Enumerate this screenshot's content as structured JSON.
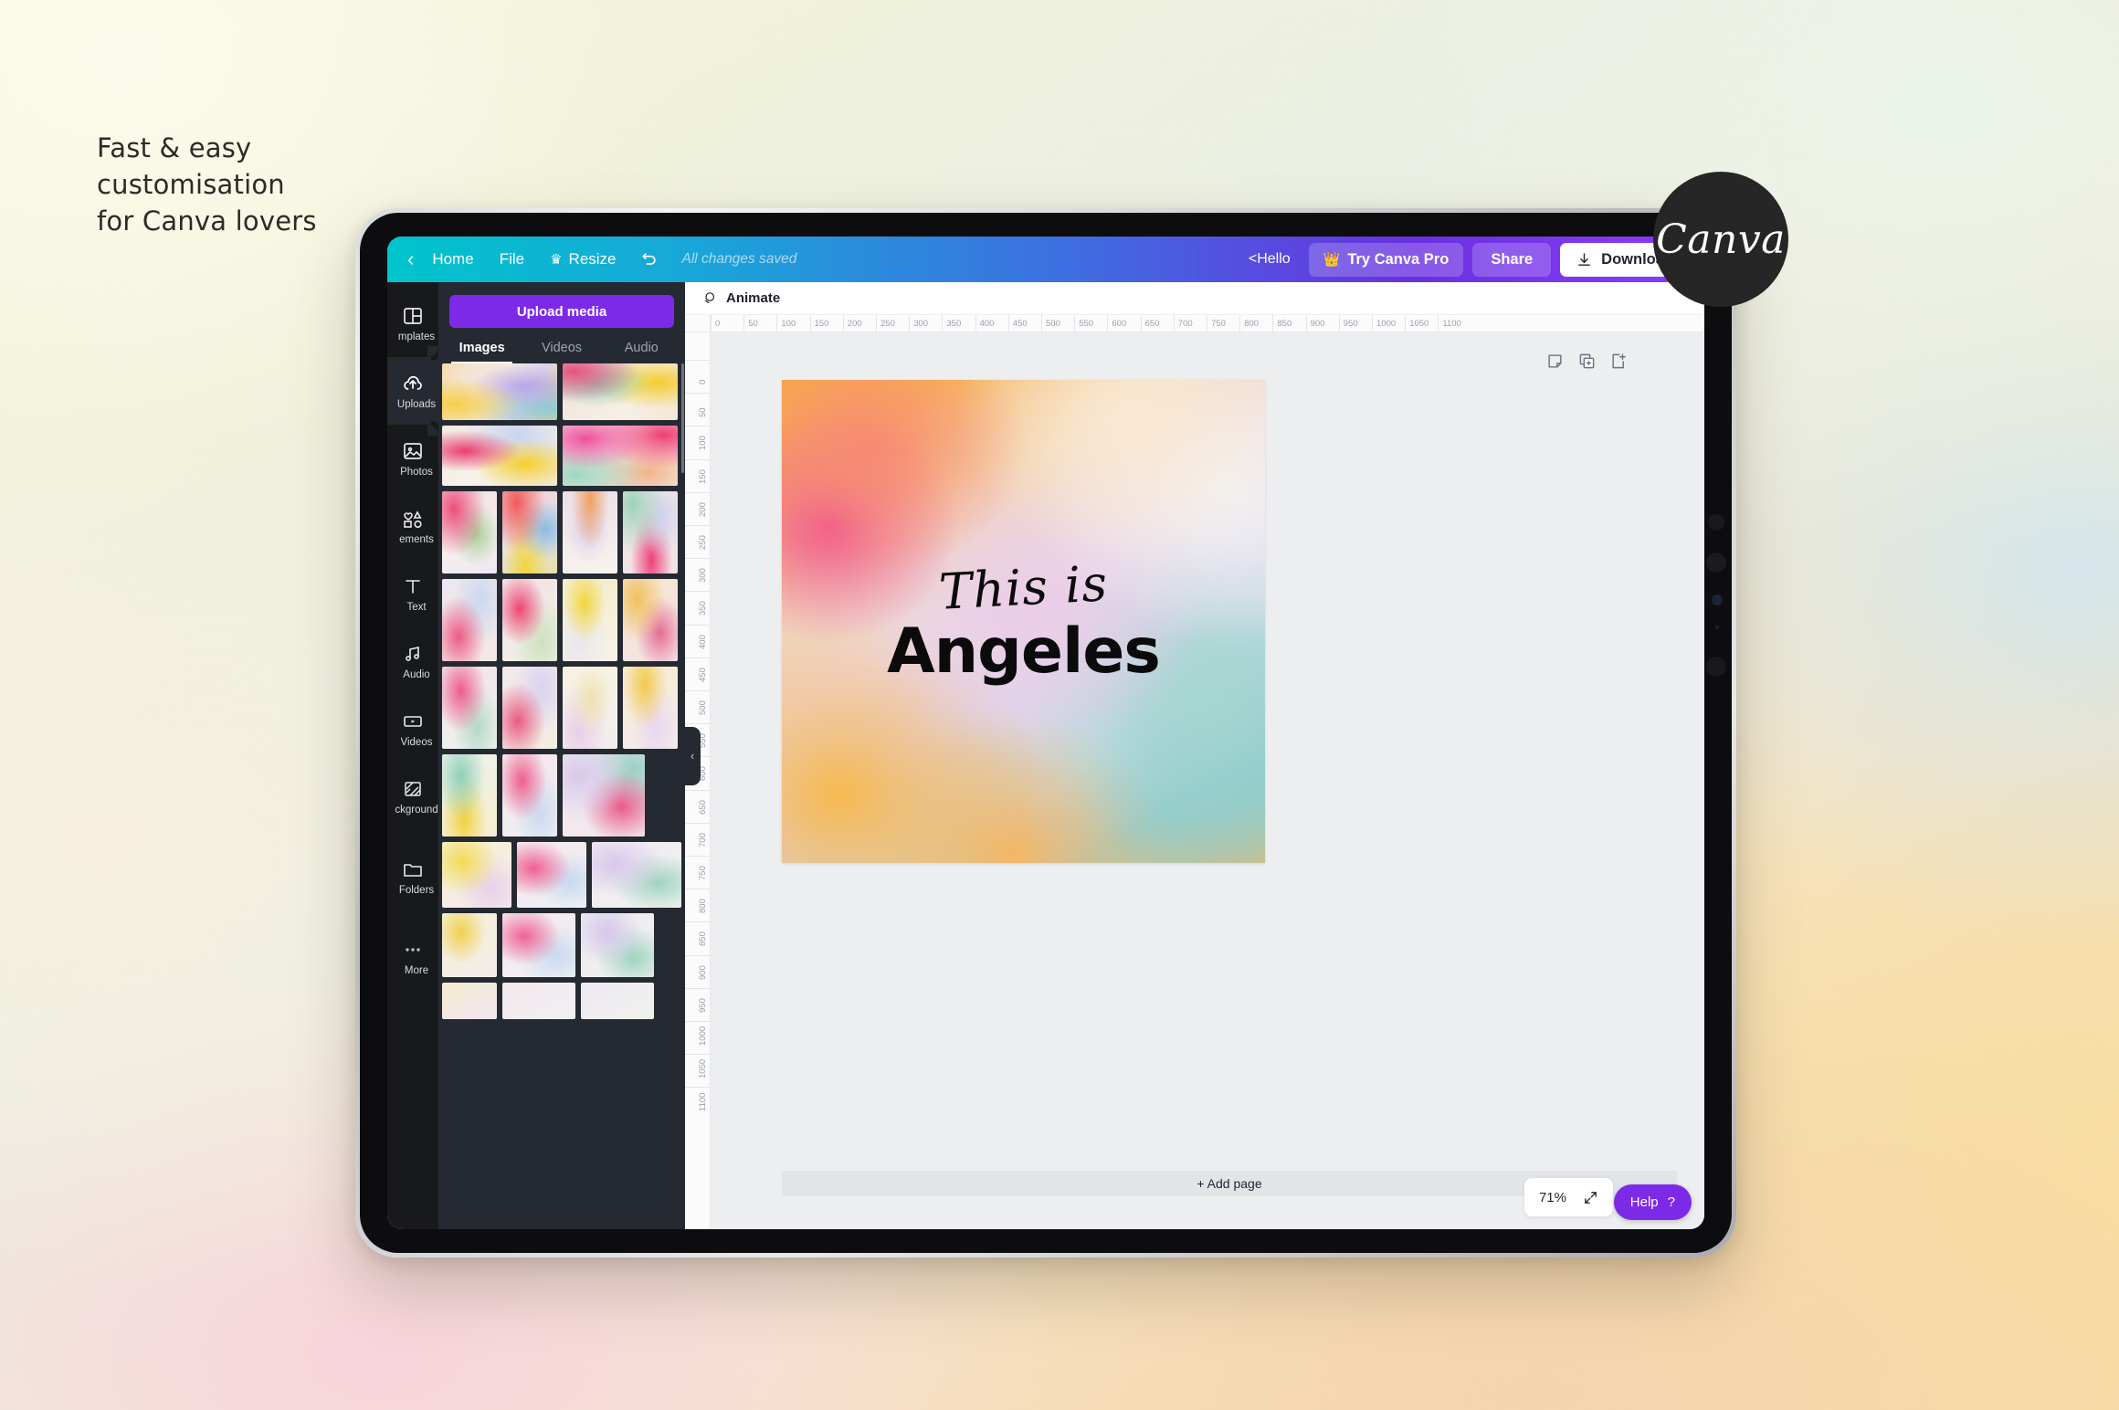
{
  "poster": {
    "headline": "Fast & easy\ncustomisation\nfor Canva lovers",
    "badge_label": "Canva"
  },
  "topbar": {
    "back_icon": "chevron-left-icon",
    "home_label": "Home",
    "file_label": "File",
    "resize_label": "Resize",
    "resize_icon": "crown-icon",
    "undo_icon": "undo-icon",
    "save_status": "All changes saved",
    "account_label": "<Hello",
    "try_pro_label": "Try Canva Pro",
    "try_pro_icon": "crown-icon",
    "share_label": "Share",
    "download_label": "Download",
    "download_icon": "download-icon"
  },
  "rail": {
    "items": [
      {
        "label": "mplates",
        "icon": "templates-icon",
        "active": false
      },
      {
        "label": "Uploads",
        "icon": "upload-cloud-icon",
        "active": true
      },
      {
        "label": "Photos",
        "icon": "photo-icon",
        "active": false
      },
      {
        "label": "ements",
        "icon": "elements-icon",
        "active": false
      },
      {
        "label": "Text",
        "icon": "text-icon",
        "active": false
      },
      {
        "label": "Audio",
        "icon": "audio-icon",
        "active": false
      },
      {
        "label": "Videos",
        "icon": "video-icon",
        "active": false
      },
      {
        "label": "ckground",
        "icon": "background-icon",
        "active": false
      },
      {
        "label": "Folders",
        "icon": "folder-icon",
        "active": false
      },
      {
        "label": "More",
        "icon": "more-dots-icon",
        "active": false
      }
    ]
  },
  "panel": {
    "upload_button": "Upload media",
    "tabs": [
      {
        "label": "Images",
        "active": true
      },
      {
        "label": "Videos",
        "active": false
      },
      {
        "label": "Audio",
        "active": false
      }
    ],
    "collapse_icon": "chevron-left-icon"
  },
  "editor": {
    "animate_label": "Animate",
    "animate_icon": "animate-icon",
    "page_tools": [
      {
        "icon": "notes-icon"
      },
      {
        "icon": "duplicate-page-icon"
      },
      {
        "icon": "add-page-icon"
      }
    ],
    "ruler_h_ticks": [
      "0",
      "50",
      "100",
      "150",
      "200",
      "250",
      "300",
      "350",
      "400",
      "450",
      "500",
      "550",
      "600",
      "650",
      "700",
      "750",
      "800",
      "850",
      "900",
      "950",
      "1000",
      "1050",
      "1100"
    ],
    "ruler_v_ticks": [
      "0",
      "50",
      "100",
      "150",
      "200",
      "250",
      "300",
      "350",
      "400",
      "450",
      "500",
      "550",
      "600",
      "650",
      "700",
      "750",
      "800",
      "850",
      "900",
      "950",
      "1000",
      "1050",
      "1100"
    ],
    "add_page_label": "+ Add page",
    "zoom_level": "71%",
    "fullscreen_icon": "expand-icon",
    "help_label": "Help",
    "help_icon": "question-mark-icon"
  },
  "design": {
    "script_text": "This is",
    "headline_text": "Angeles"
  },
  "colors": {
    "canva_purple": "#7d2ae8",
    "panel_bg": "#252932",
    "rail_bg": "#18191b",
    "topbar_from": "#00c4cc",
    "topbar_to": "#8b3dfa"
  }
}
